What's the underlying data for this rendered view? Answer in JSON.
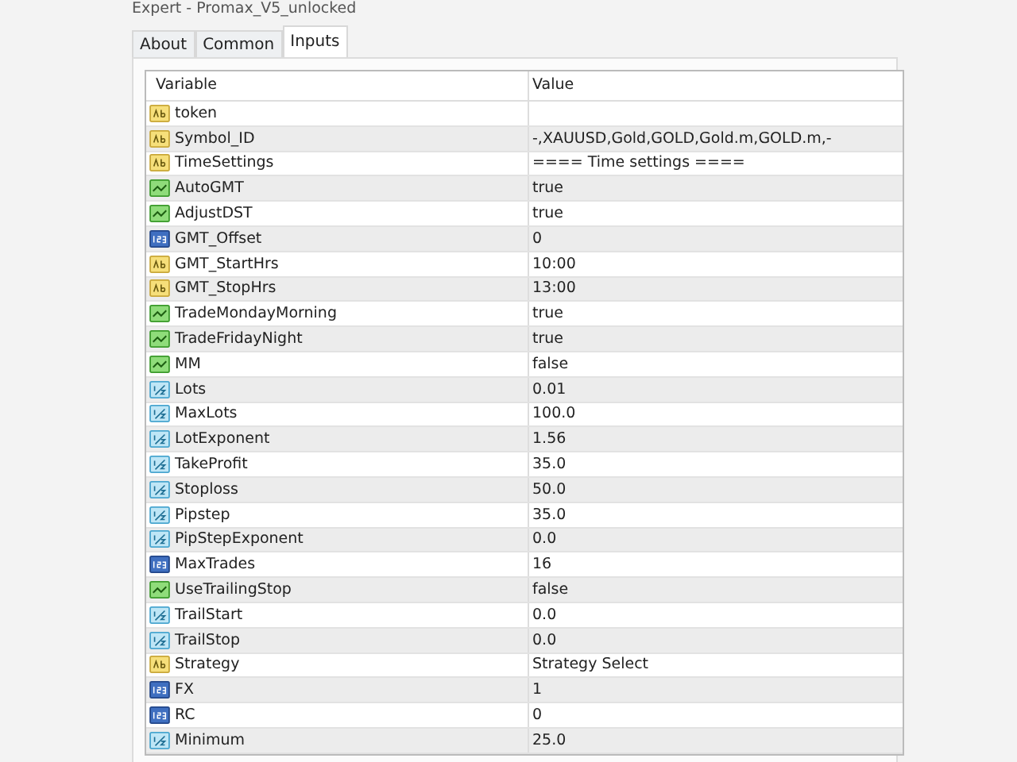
{
  "window": {
    "title": "Expert - Promax_V5_unlocked"
  },
  "tabs": [
    {
      "label": "About",
      "selected": false
    },
    {
      "label": "Common",
      "selected": false
    },
    {
      "label": "Inputs",
      "selected": true
    }
  ],
  "table": {
    "columns": [
      "Variable",
      "Value"
    ],
    "rows": [
      {
        "kind": "string",
        "variable": "token",
        "value": ""
      },
      {
        "kind": "string",
        "variable": "Symbol_ID",
        "value": "-,XAUUSD,Gold,GOLD,Gold.m,GOLD.m,-"
      },
      {
        "kind": "string",
        "variable": "TimeSettings",
        "value": "==== Time settings ===="
      },
      {
        "kind": "bool",
        "variable": "AutoGMT",
        "value": "true"
      },
      {
        "kind": "bool",
        "variable": "AdjustDST",
        "value": "true"
      },
      {
        "kind": "int",
        "variable": "GMT_Offset",
        "value": "0"
      },
      {
        "kind": "string",
        "variable": "GMT_StartHrs",
        "value": "10:00"
      },
      {
        "kind": "string",
        "variable": "GMT_StopHrs",
        "value": "13:00"
      },
      {
        "kind": "bool",
        "variable": "TradeMondayMorning",
        "value": "true"
      },
      {
        "kind": "bool",
        "variable": "TradeFridayNight",
        "value": "true"
      },
      {
        "kind": "bool",
        "variable": "MM",
        "value": "false"
      },
      {
        "kind": "double",
        "variable": "Lots",
        "value": "0.01"
      },
      {
        "kind": "double",
        "variable": "MaxLots",
        "value": "100.0"
      },
      {
        "kind": "double",
        "variable": "LotExponent",
        "value": "1.56"
      },
      {
        "kind": "double",
        "variable": "TakeProfit",
        "value": "35.0"
      },
      {
        "kind": "double",
        "variable": "Stoploss",
        "value": "50.0"
      },
      {
        "kind": "double",
        "variable": "Pipstep",
        "value": "35.0"
      },
      {
        "kind": "double",
        "variable": "PipStepExponent",
        "value": "0.0"
      },
      {
        "kind": "int",
        "variable": "MaxTrades",
        "value": "16"
      },
      {
        "kind": "bool",
        "variable": "UseTrailingStop",
        "value": "false"
      },
      {
        "kind": "double",
        "variable": "TrailStart",
        "value": "0.0"
      },
      {
        "kind": "double",
        "variable": "TrailStop",
        "value": "0.0"
      },
      {
        "kind": "string",
        "variable": "Strategy",
        "value": "Strategy Select"
      },
      {
        "kind": "int",
        "variable": "FX",
        "value": "1"
      },
      {
        "kind": "int",
        "variable": "RC",
        "value": "0"
      },
      {
        "kind": "double",
        "variable": "Minimum",
        "value": "25.0"
      }
    ]
  }
}
